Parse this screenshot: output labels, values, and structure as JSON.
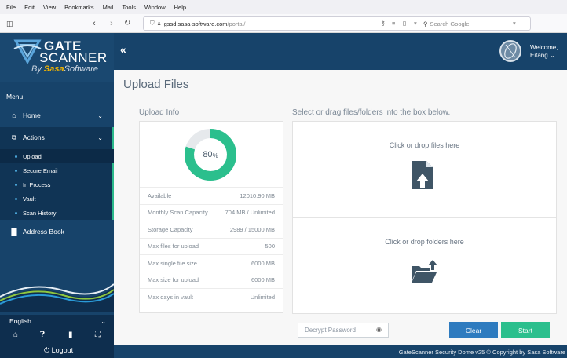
{
  "browser": {
    "menus": [
      "File",
      "Edit",
      "View",
      "Bookmarks",
      "Mail",
      "Tools",
      "Window",
      "Help"
    ],
    "url_host": "gssd.sasa-software.com",
    "url_path": "/portal/",
    "search_placeholder": "Search Google"
  },
  "logo": {
    "line1": "GATE",
    "line2": "SCANNER",
    "by": "By",
    "brand1": "Sasa",
    "brand2": "Software"
  },
  "sidebar": {
    "menu_title": "Menu",
    "home": "Home",
    "actions": "Actions",
    "sub_items": [
      "Upload",
      "Secure Email",
      "In Process",
      "Vault",
      "Scan History"
    ],
    "address_book": "Address Book",
    "language": "English",
    "logout": "Logout"
  },
  "header": {
    "welcome": "Welcome,",
    "user": "Eitang ⌄"
  },
  "main": {
    "title": "Upload Files",
    "info_label": "Upload Info",
    "drop_label": "Select or drag files/folders into the box below.",
    "percent_value": "80",
    "percent_unit": "%",
    "progress_fraction": 0.8,
    "info_rows": [
      {
        "label": "Available",
        "value": "12010.90 MB"
      },
      {
        "label": "Monthly Scan Capacity",
        "value": "704 MB / Unlimited"
      },
      {
        "label": "Storage Capacity",
        "value": "2989 / 15000 MB"
      },
      {
        "label": "Max files for upload",
        "value": "500"
      },
      {
        "label": "Max single file size",
        "value": "6000 MB"
      },
      {
        "label": "Max size for upload",
        "value": "6000 MB"
      },
      {
        "label": "Max days in vault",
        "value": "Unlimited"
      }
    ],
    "drop_files": "Click or drop files here",
    "drop_folders": "Click or drop folders here",
    "password_placeholder": "Decrypt Password",
    "clear": "Clear",
    "start": "Start"
  },
  "footer": "GateScanner Security Dome v25 © Copyright by Sasa Software",
  "colors": {
    "navy": "#17436a",
    "accent_green": "#2bbf8d",
    "clear_blue": "#2e7bbf"
  }
}
